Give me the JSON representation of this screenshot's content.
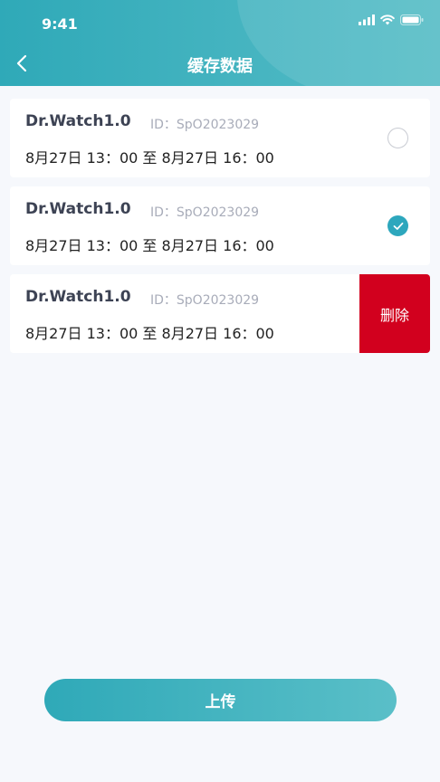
{
  "status_bar": {
    "time": "9:41"
  },
  "header": {
    "title": "缓存数据",
    "back_icon": "chevron-left-icon"
  },
  "records": [
    {
      "device": "Dr.Watch1.0",
      "id": "ID：SpO2023029",
      "range": "8月27日  13：00 至 8月27日  16：00",
      "selected": false
    },
    {
      "device": "Dr.Watch1.0",
      "id": "ID：SpO2023029",
      "range": "8月27日  13：00 至 8月27日  16：00",
      "selected": true
    },
    {
      "device": "Dr.Watch1.0",
      "id": "ID：SpO2023029",
      "range": "8月27日  13：00 至 8月27日  16：00",
      "delete_label": "删除"
    }
  ],
  "upload_button": {
    "label": "上传"
  },
  "colors": {
    "primary": "#2fa9b8",
    "delete": "#d2001e",
    "background": "#f6f8fc"
  }
}
